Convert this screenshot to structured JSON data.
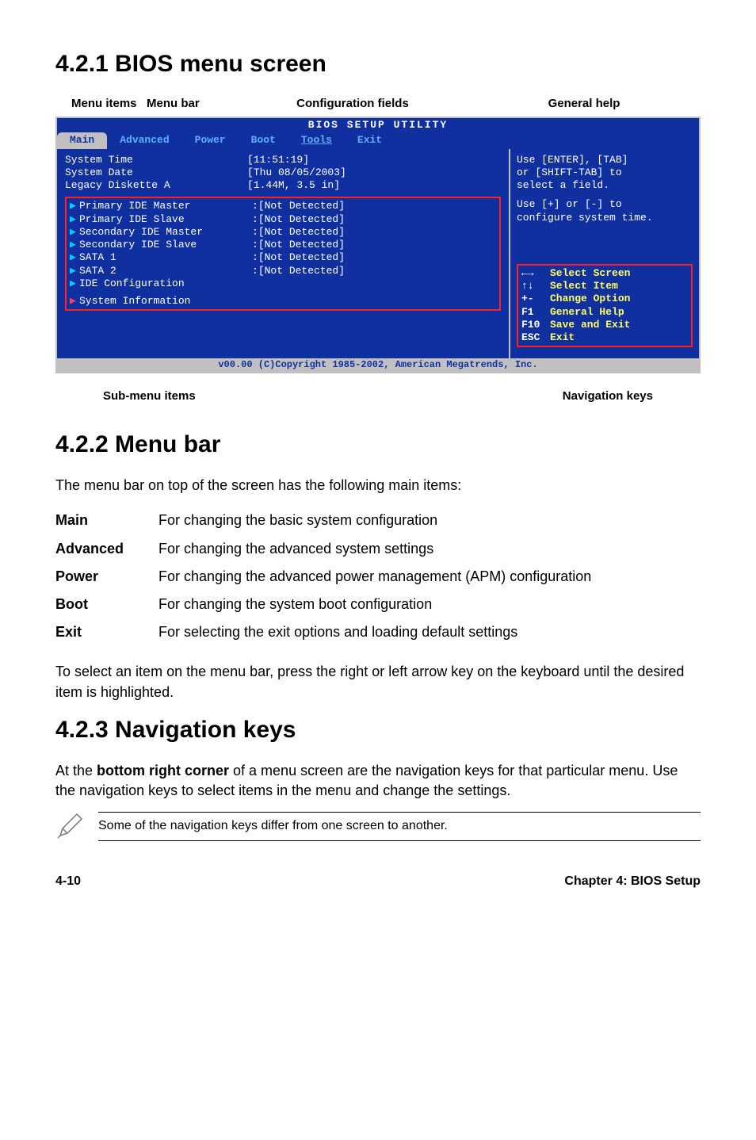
{
  "section421": {
    "title": "4.2.1  BIOS menu screen"
  },
  "labelsTop": {
    "menuitems": "Menu items",
    "menubar": "Menu bar",
    "config": "Configuration fields",
    "general": "General help"
  },
  "bios": {
    "title": "BIOS SETUP UTILITY",
    "tabs": {
      "main": "Main",
      "advanced": "Advanced",
      "power": "Power",
      "boot": "Boot",
      "tools": "Tools",
      "exit": "Exit"
    },
    "rows": {
      "systime_l": "System Time",
      "systime_v": "[11:51:19]",
      "sysdate_l": "System Date",
      "sysdate_v": "[Thu 08/05/2003]",
      "legacy_l": "Legacy Diskette A",
      "legacy_v": "[1.44M, 3.5 in]",
      "pim": "Primary IDE Master",
      "pis": "Primary IDE Slave",
      "sem": "Secondary IDE Master",
      "ses": "Secondary IDE Slave",
      "sata1": "SATA 1",
      "sata2": "SATA 2",
      "idec": "IDE Configuration",
      "sysinfo": "System Information",
      "nd": "[Not Detected]"
    },
    "help": {
      "l1": "Use [ENTER], [TAB]",
      "l2": "or [SHIFT-TAB] to",
      "l3": "select a field.",
      "l4": "Use [+] or [-] to",
      "l5": "configure system time."
    },
    "keys": {
      "k1": "←→",
      "d1": "Select Screen",
      "k2": "↑↓",
      "d2": "Select Item",
      "k3": "+-",
      "d3": "Change Option",
      "k4": "F1",
      "d4": "General Help",
      "k5": "F10",
      "d5": "Save and Exit",
      "k6": "ESC",
      "d6": "Exit"
    },
    "footer": "v00.00 (C)Copyright 1985-2002, American Megatrends, Inc."
  },
  "labelsBottom": {
    "sub": "Sub-menu items",
    "nav": "Navigation keys"
  },
  "section422": {
    "title": "4.2.2  Menu bar",
    "intro": "The menu bar on top of the screen has the following main items:",
    "defs": {
      "main_t": "Main",
      "main_d": "For changing the basic system configuration",
      "adv_t": "Advanced",
      "adv_d": "For changing the advanced system settings",
      "pow_t": "Power",
      "pow_d": "For changing the advanced power management (APM) configuration",
      "boot_t": "Boot",
      "boot_d": "For changing the system boot configuration",
      "exit_t": "Exit",
      "exit_d": "For selecting the exit options and loading default settings"
    },
    "outro": "To select an item on the menu bar, press the right or left arrow key on the keyboard until the desired item is highlighted."
  },
  "section423": {
    "title": "4.2.3  Navigation keys",
    "body_pre": "At the ",
    "body_bold": "bottom right corner",
    "body_post": " of a menu screen are the navigation keys for that particular menu. Use the navigation keys to select items in the menu and change the settings."
  },
  "note": "Some of the navigation keys differ from one screen to another.",
  "footer": {
    "page": "4-10",
    "chapter": "Chapter 4: BIOS Setup"
  }
}
